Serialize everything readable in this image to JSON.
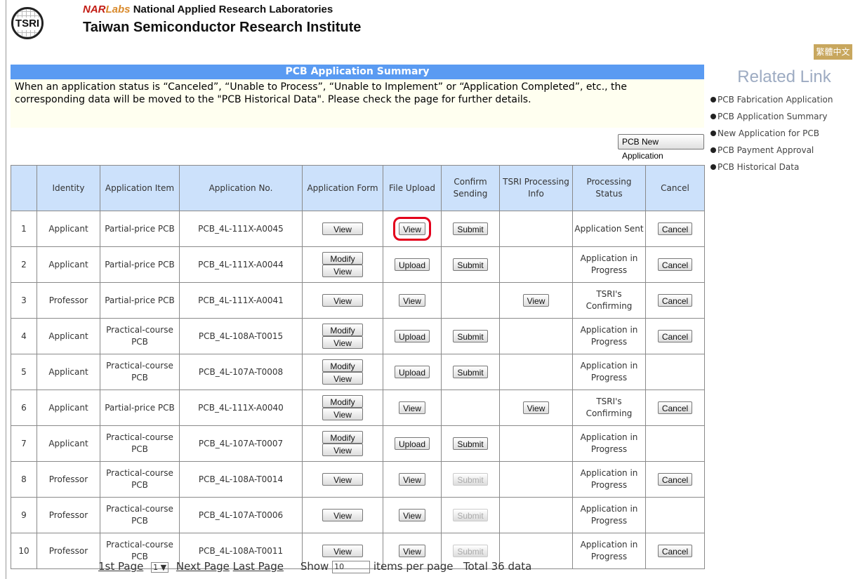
{
  "header": {
    "logo_text": "TSRI",
    "org_nar": "NAR",
    "org_labs": "Labs",
    "org_name": "National Applied Research Laboratories",
    "institute": "Taiwan Semiconductor Research Institute",
    "lang_button": "繁體中文"
  },
  "summary": {
    "title": "PCB Application Summary",
    "notice_line1": "When an application status is “Canceled”, “Unable to Process”, “Unable to Implement” or “Application Completed”, etc., the",
    "notice_line2": "corresponding data will be moved to the \"PCB Historical Data\". Please check the page for further details.",
    "new_app_button": "PCB New Application"
  },
  "table": {
    "columns": [
      "",
      "Identity",
      "Application Item",
      "Application No.",
      "Application Form",
      "File Upload",
      "Confirm Sending",
      "TSRI Processing Info",
      "Processing Status",
      "Cancel"
    ],
    "rows": [
      {
        "num": "1",
        "identity": "Applicant",
        "item": "Partial-price PCB",
        "app_no": "PCB_4L-111X-A0045",
        "form": [
          "View"
        ],
        "upload": "View",
        "upload_highlight": true,
        "confirm": "Submit",
        "confirm_disabled": false,
        "tsri": "",
        "status": "Application Sent",
        "cancel": "Cancel"
      },
      {
        "num": "2",
        "identity": "Applicant",
        "item": "Partial-price PCB",
        "app_no": "PCB_4L-111X-A0044",
        "form": [
          "Modify",
          "View"
        ],
        "upload": "Upload",
        "upload_highlight": false,
        "confirm": "Submit",
        "confirm_disabled": false,
        "tsri": "",
        "status": "Application in Progress",
        "cancel": "Cancel"
      },
      {
        "num": "3",
        "identity": "Professor",
        "item": "Partial-price PCB",
        "app_no": "PCB_4L-111X-A0041",
        "form": [
          "View"
        ],
        "upload": "View",
        "upload_highlight": false,
        "confirm": "",
        "confirm_disabled": false,
        "tsri": "View",
        "status": "TSRI's Confirming",
        "cancel": "Cancel"
      },
      {
        "num": "4",
        "identity": "Applicant",
        "item": "Practical-course PCB",
        "app_no": "PCB_4L-108A-T0015",
        "form": [
          "Modify",
          "View"
        ],
        "upload": "Upload",
        "upload_highlight": false,
        "confirm": "Submit",
        "confirm_disabled": false,
        "tsri": "",
        "status": "Application in Progress",
        "cancel": "Cancel"
      },
      {
        "num": "5",
        "identity": "Applicant",
        "item": "Practical-course PCB",
        "app_no": "PCB_4L-107A-T0008",
        "form": [
          "Modify",
          "View"
        ],
        "upload": "Upload",
        "upload_highlight": false,
        "confirm": "Submit",
        "confirm_disabled": false,
        "tsri": "",
        "status": "Application in Progress",
        "cancel": ""
      },
      {
        "num": "6",
        "identity": "Applicant",
        "item": "Partial-price PCB",
        "app_no": "PCB_4L-111X-A0040",
        "form": [
          "Modify",
          "View"
        ],
        "upload": "View",
        "upload_highlight": false,
        "confirm": "",
        "confirm_disabled": false,
        "tsri": "View",
        "status": "TSRI's Confirming",
        "cancel": "Cancel"
      },
      {
        "num": "7",
        "identity": "Applicant",
        "item": "Practical-course PCB",
        "app_no": "PCB_4L-107A-T0007",
        "form": [
          "Modify",
          "View"
        ],
        "upload": "Upload",
        "upload_highlight": false,
        "confirm": "Submit",
        "confirm_disabled": false,
        "tsri": "",
        "status": "Application in Progress",
        "cancel": ""
      },
      {
        "num": "8",
        "identity": "Professor",
        "item": "Practical-course PCB",
        "app_no": "PCB_4L-108A-T0014",
        "form": [
          "View"
        ],
        "upload": "View",
        "upload_highlight": false,
        "confirm": "Submit",
        "confirm_disabled": true,
        "tsri": "",
        "status": "Application in Progress",
        "cancel": "Cancel"
      },
      {
        "num": "9",
        "identity": "Professor",
        "item": "Practical-course PCB",
        "app_no": "PCB_4L-107A-T0006",
        "form": [
          "View"
        ],
        "upload": "View",
        "upload_highlight": false,
        "confirm": "Submit",
        "confirm_disabled": true,
        "tsri": "",
        "status": "Application in Progress",
        "cancel": ""
      },
      {
        "num": "10",
        "identity": "Professor",
        "item": "Practical-course PCB",
        "app_no": "PCB_4L-108A-T0011",
        "form": [
          "View"
        ],
        "upload": "View",
        "upload_highlight": false,
        "confirm": "Submit",
        "confirm_disabled": true,
        "tsri": "",
        "status": "Application in Progress",
        "cancel": "Cancel"
      }
    ]
  },
  "pager": {
    "first": "1st Page",
    "page_select": "1",
    "next": "Next Page",
    "last": "Last Page",
    "show_label": "Show",
    "per_page_value": "10",
    "per_page_label": "items per page",
    "total": "Total 36 data"
  },
  "related": {
    "title": "Related Link",
    "links": [
      "PCB Fabrication Application",
      "PCB Application Summary",
      "New Application for PCB",
      "PCB Payment Approval",
      "PCB Historical Data"
    ]
  },
  "colors": {
    "summary_header": "#5a9bf2",
    "table_header": "#cce1fb",
    "notice_bg": "#fffff0",
    "lang_button": "#c8a75e",
    "highlight": "#e3001b",
    "related_title": "#9dabc2"
  }
}
